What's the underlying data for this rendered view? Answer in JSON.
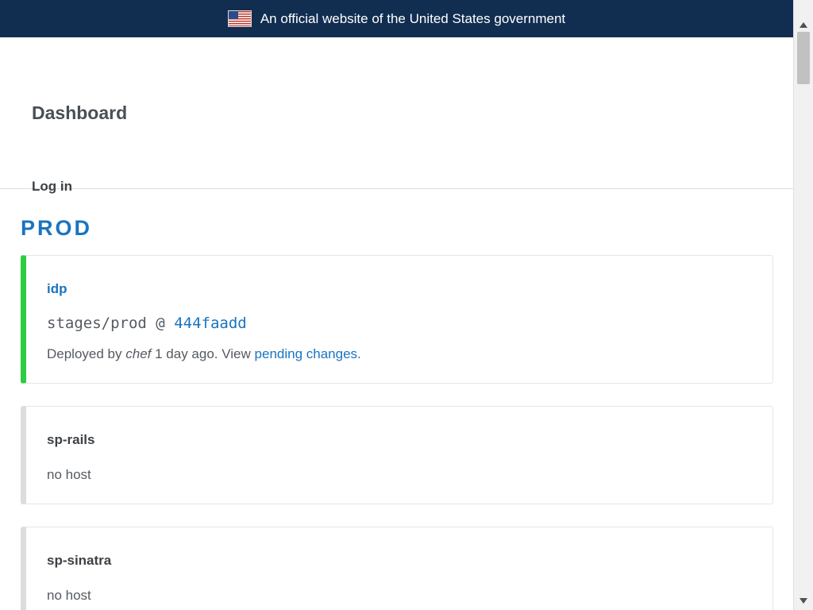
{
  "gov_banner": {
    "text": "An official website of the United States government"
  },
  "header": {
    "title": "Dashboard",
    "login_label": "Log in"
  },
  "environment": {
    "name": "PROD"
  },
  "cards": [
    {
      "title": "idp",
      "branch": "stages/prod",
      "separator": "@",
      "sha": "444faadd",
      "deployed_prefix": "Deployed by",
      "deployed_by": "chef",
      "deployed_ago": "1 day ago. View",
      "pending_link": "pending changes",
      "deployed_suffix": ".",
      "status_color": "#2ecc40"
    },
    {
      "title": "sp-rails",
      "host": "no host"
    },
    {
      "title": "sp-sinatra",
      "host": "no host"
    }
  ],
  "colors": {
    "banner_bg": "#112e51",
    "link": "#1a74c0",
    "success": "#2ecc40"
  }
}
